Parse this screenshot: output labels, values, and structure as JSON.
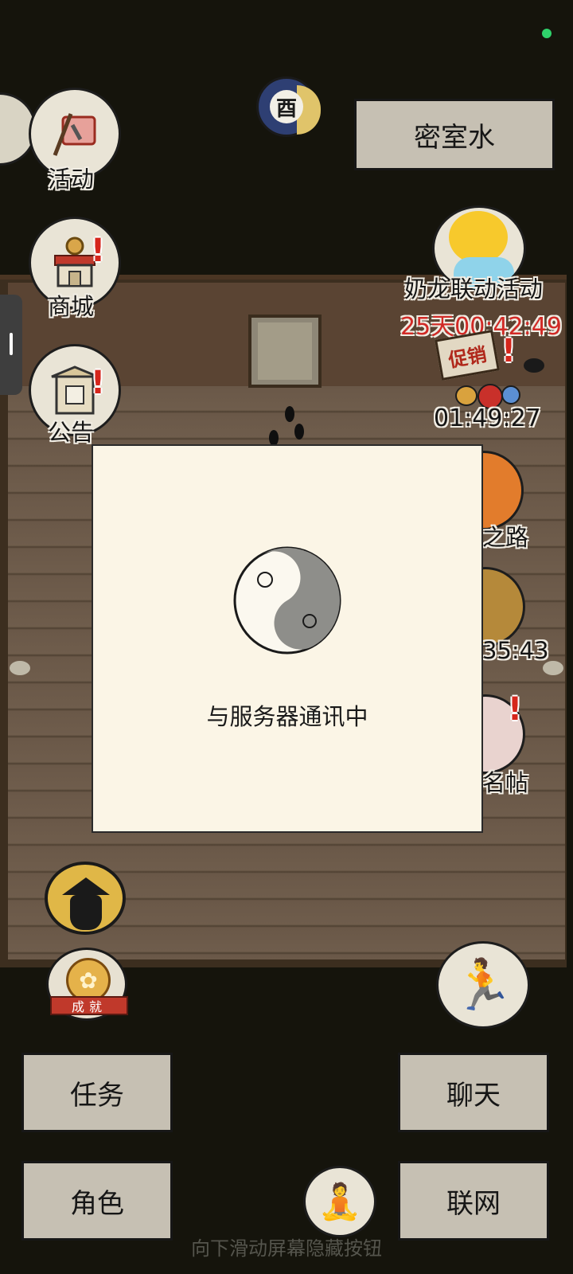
{
  "top_button": {
    "label": "密室水"
  },
  "left_menu": [
    {
      "label": "活动",
      "icon": "flag-sword-icon"
    },
    {
      "label": "商城",
      "icon": "shop-icon",
      "alert": "!"
    },
    {
      "label": "公告",
      "icon": "notice-board-icon",
      "alert": "!"
    }
  ],
  "right_menu": {
    "event": {
      "label": "奶龙联动活动",
      "timer": "25天00:42:49",
      "icon": "yellow-dragon-icon"
    },
    "sale": {
      "sign": "促销",
      "timer": "01:49:27",
      "alert": "!"
    },
    "partial_labels": [
      "之路",
      "35:43",
      "名帖"
    ]
  },
  "modal": {
    "message": "与服务器通讯中",
    "icon": "yin-yang-icon"
  },
  "bottom_buttons": {
    "quest": "任务",
    "chat": "聊天",
    "character": "角色",
    "online": "联网"
  },
  "medal": {
    "label": "成就"
  },
  "moon_badge": {
    "label": "酉"
  },
  "hint": "向下滑动屏幕隐藏按钮",
  "colors": {
    "background": "#15140c",
    "button": "#c6c0b3",
    "modal": "#fbf5e6",
    "alert": "#d5261c",
    "timer_red": "#d12a26",
    "status": "#2fd26b"
  }
}
